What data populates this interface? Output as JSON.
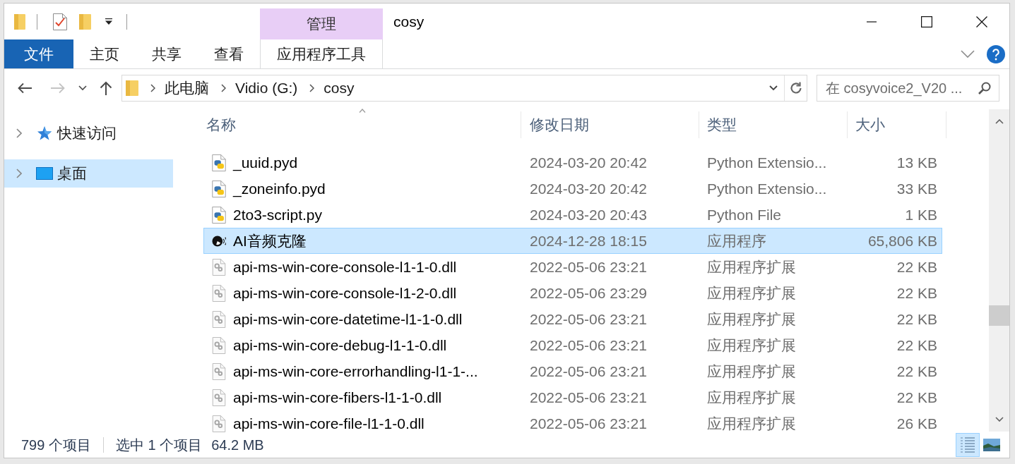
{
  "window": {
    "title": "cosy"
  },
  "ribbon": {
    "tabs": [
      {
        "label": "文件",
        "kind": "file",
        "selected": false
      },
      {
        "label": "主页",
        "kind": "tab",
        "selected": false
      },
      {
        "label": "共享",
        "kind": "tab",
        "selected": false
      },
      {
        "label": "查看",
        "kind": "tab",
        "selected": false
      },
      {
        "label": "应用程序工具",
        "kind": "contextual",
        "group": "管理",
        "selected": false
      }
    ]
  },
  "nav_buttons": [
    {
      "kind": "back",
      "disabled": false
    },
    {
      "kind": "forward",
      "disabled": true
    },
    {
      "kind": "recent",
      "disabled": false
    },
    {
      "kind": "up",
      "disabled": false
    }
  ],
  "address_bar": {
    "path": [
      "此电脑",
      "Vidio (G:)",
      "cosy"
    ]
  },
  "search": {
    "placeholder": "在 cosyvoice2_V20 ..."
  },
  "navigation_pane": {
    "items": [
      {
        "label": "快速访问",
        "kind": "quick_access",
        "expanded": false,
        "selected": false
      },
      {
        "label": "桌面",
        "kind": "desktop",
        "expanded": false,
        "selected": true
      }
    ]
  },
  "file_list": {
    "columns": [
      {
        "label": "名称",
        "sorted": true
      },
      {
        "label": "修改日期",
        "sorted": false
      },
      {
        "label": "类型",
        "sorted": false
      },
      {
        "label": "大小",
        "sorted": false
      }
    ],
    "rows": [
      {
        "name": "_uuid.pyd",
        "kind": "python",
        "modified": "2024-03-20 20:42",
        "type": "Python Extensio...",
        "size": "13 KB",
        "selected": false
      },
      {
        "name": "_zoneinfo.pyd",
        "kind": "python",
        "modified": "2024-03-20 20:42",
        "type": "Python Extensio...",
        "size": "33 KB",
        "selected": false
      },
      {
        "name": "2to3-script.py",
        "kind": "python",
        "modified": "2024-03-20 20:43",
        "type": "Python File",
        "size": "1 KB",
        "selected": false
      },
      {
        "name": "AI音频克隆",
        "kind": "app",
        "modified": "2024-12-28 18:15",
        "type": "应用程序",
        "size": "65,806 KB",
        "selected": true
      },
      {
        "name": "api-ms-win-core-console-l1-1-0.dll",
        "kind": "dll",
        "modified": "2022-05-06 23:21",
        "type": "应用程序扩展",
        "size": "22 KB",
        "selected": false
      },
      {
        "name": "api-ms-win-core-console-l1-2-0.dll",
        "kind": "dll",
        "modified": "2022-05-06 23:29",
        "type": "应用程序扩展",
        "size": "22 KB",
        "selected": false
      },
      {
        "name": "api-ms-win-core-datetime-l1-1-0.dll",
        "kind": "dll",
        "modified": "2022-05-06 23:21",
        "type": "应用程序扩展",
        "size": "22 KB",
        "selected": false
      },
      {
        "name": "api-ms-win-core-debug-l1-1-0.dll",
        "kind": "dll",
        "modified": "2022-05-06 23:21",
        "type": "应用程序扩展",
        "size": "22 KB",
        "selected": false
      },
      {
        "name": "api-ms-win-core-errorhandling-l1-1-...",
        "kind": "dll",
        "modified": "2022-05-06 23:21",
        "type": "应用程序扩展",
        "size": "22 KB",
        "selected": false
      },
      {
        "name": "api-ms-win-core-fibers-l1-1-0.dll",
        "kind": "dll",
        "modified": "2022-05-06 23:21",
        "type": "应用程序扩展",
        "size": "22 KB",
        "selected": false
      },
      {
        "name": "api-ms-win-core-file-l1-1-0.dll",
        "kind": "dll",
        "modified": "2022-05-06 23:21",
        "type": "应用程序扩展",
        "size": "26 KB",
        "selected": false
      }
    ]
  },
  "status_bar": {
    "item_count": "799 个项目",
    "selection": "选中 1 个项目",
    "selection_size": "64.2 MB",
    "views": [
      {
        "kind": "details",
        "selected": true
      },
      {
        "kind": "large_icons",
        "selected": false
      }
    ]
  }
}
